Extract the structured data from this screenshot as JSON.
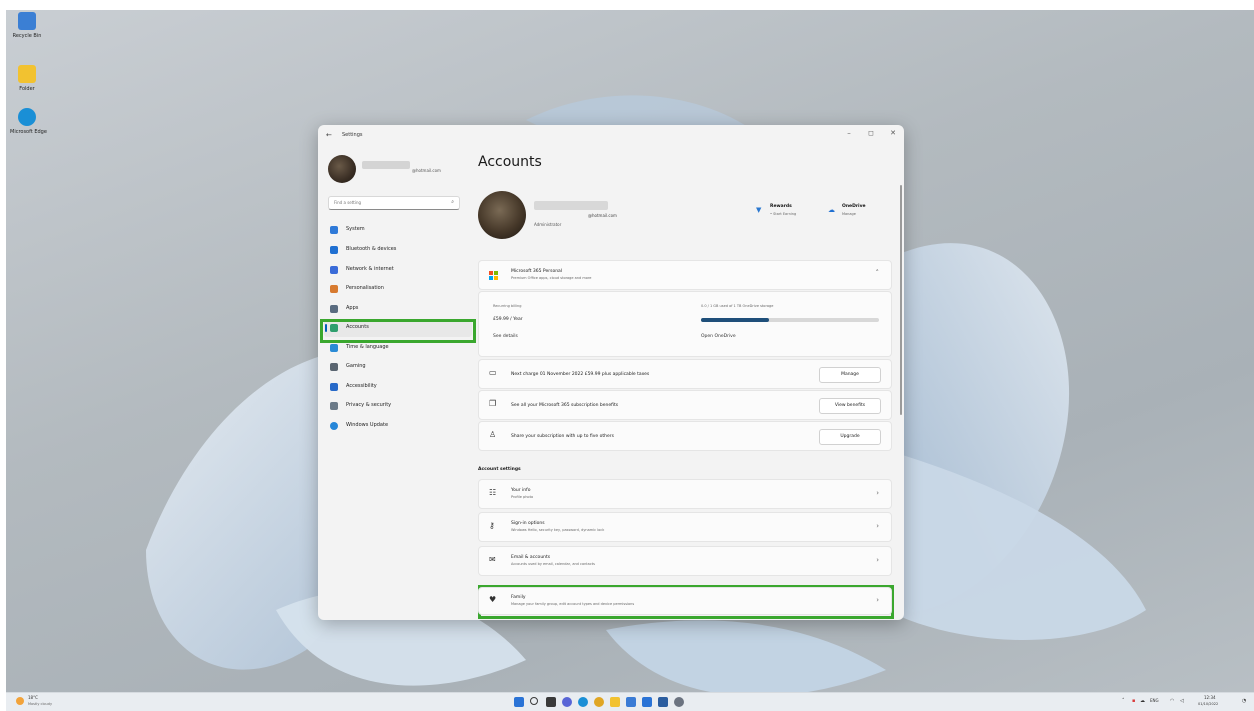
{
  "desktop": {
    "icons": [
      {
        "label": "Recycle Bin",
        "icon": "recycle-bin-icon",
        "color": "#3b7fd4"
      },
      {
        "label": "Folder",
        "icon": "folder-icon",
        "color": "#f2c230"
      },
      {
        "label": "Microsoft Edge",
        "icon": "edge-icon",
        "color": "#1a8fd6"
      }
    ]
  },
  "window": {
    "title": "Settings",
    "controls": {
      "minimize": "–",
      "maximize": "◻",
      "close": "✕"
    }
  },
  "sidebar": {
    "email_suffix": "@hotmail.com",
    "search_placeholder": "Find a setting",
    "items": [
      {
        "label": "System",
        "icon": "monitor-icon",
        "color": "#2f7ad8"
      },
      {
        "label": "Bluetooth & devices",
        "icon": "bluetooth-icon",
        "color": "#1f6fd1"
      },
      {
        "label": "Network & internet",
        "icon": "wifi-icon",
        "color": "#3a6bd8"
      },
      {
        "label": "Personalisation",
        "icon": "brush-icon",
        "color": "#d77a2f"
      },
      {
        "label": "Apps",
        "icon": "apps-icon",
        "color": "#5a6c80"
      },
      {
        "label": "Accounts",
        "icon": "person-icon",
        "color": "#2f9f6e"
      },
      {
        "label": "Time & language",
        "icon": "globe-clock-icon",
        "color": "#2a8bd6"
      },
      {
        "label": "Gaming",
        "icon": "controller-icon",
        "color": "#5a6570"
      },
      {
        "label": "Accessibility",
        "icon": "accessibility-icon",
        "color": "#2769c8"
      },
      {
        "label": "Privacy & security",
        "icon": "shield-icon",
        "color": "#6b7a88"
      },
      {
        "label": "Windows Update",
        "icon": "update-icon",
        "color": "#2586d8"
      }
    ]
  },
  "main": {
    "title": "Accounts",
    "account": {
      "email_suffix": "@hotmail.com",
      "role": "Administrator"
    },
    "perks": [
      {
        "title": "Rewards",
        "sub": "• Start Earning",
        "icon": "trophy-icon",
        "color": "#2b78d0"
      },
      {
        "title": "OneDrive",
        "sub": "Manage",
        "icon": "cloud-icon",
        "color": "#1f6fd1"
      }
    ],
    "subscription": {
      "title": "Microsoft 365 Personal",
      "sub": "Premium Office apps, cloud storage and more",
      "billing_label": "Recurring billing",
      "price": "£59.99 / Year",
      "see_details": "See details",
      "storage_label": "0.0 / 1 GB used of 1 TB OneDrive storage",
      "storage_used_fraction": 0.38,
      "open_onedrive": "Open OneDrive"
    },
    "actions": [
      {
        "text": "Next charge 01 November 2022 £59.99 plus applicable taxes",
        "button": "Manage",
        "icon": "card-icon"
      },
      {
        "text": "See all your Microsoft 365 subscription benefits",
        "button": "View benefits",
        "icon": "gift-icon"
      },
      {
        "text": "Share your subscription with up to five others",
        "button": "Upgrade",
        "icon": "people-icon"
      }
    ],
    "account_settings_label": "Account settings",
    "settings": [
      {
        "title": "Your info",
        "sub": "Profile photo",
        "icon": "id-card-icon"
      },
      {
        "title": "Sign-in options",
        "sub": "Windows Hello, security key, password, dynamic lock",
        "icon": "key-icon"
      },
      {
        "title": "Email & accounts",
        "sub": "Accounts used by email, calendar, and contacts",
        "icon": "mail-icon"
      },
      {
        "title": "Family",
        "sub": "Manage your family group, edit account types and device permissions",
        "icon": "heart-icon"
      }
    ]
  },
  "taskbar": {
    "weather_temp": "18°C",
    "weather_text": "Mostly cloudy",
    "tray_lang": "ENG",
    "clock_time": "12:34",
    "clock_date": "01/10/2022",
    "apps": [
      {
        "icon": "start-icon",
        "color": "#2a73d6"
      },
      {
        "icon": "search-icon",
        "color": "#3a3a3a"
      },
      {
        "icon": "task-view-icon",
        "color": "#3a3a3a"
      },
      {
        "icon": "chat-icon",
        "color": "#5865d6"
      },
      {
        "icon": "edge-taskbar-icon",
        "color": "#1a8fd6"
      },
      {
        "icon": "chrome-icon",
        "color": "#e0a623"
      },
      {
        "icon": "file-explorer-icon",
        "color": "#f2c230"
      },
      {
        "icon": "store-icon",
        "color": "#3a7bd5"
      },
      {
        "icon": "mail-taskbar-icon",
        "color": "#2a73d6"
      },
      {
        "icon": "photos-icon",
        "color": "#2b5d9f"
      },
      {
        "icon": "settings-gear-icon",
        "color": "#6b7380"
      }
    ]
  },
  "colors": {
    "accent": "#005fb8",
    "highlight": "#3aa72e"
  }
}
